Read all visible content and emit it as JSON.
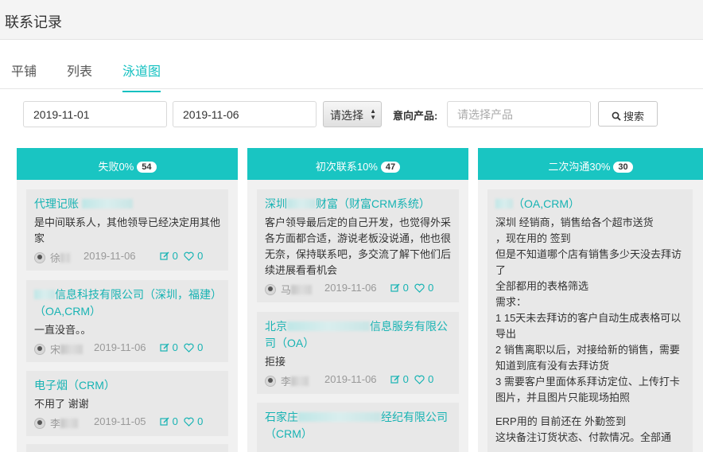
{
  "page": {
    "title": "联系记录"
  },
  "tabs": [
    {
      "label": "平铺",
      "active": false
    },
    {
      "label": "列表",
      "active": false
    },
    {
      "label": "泳道图",
      "active": true
    }
  ],
  "filters": {
    "start_date": "2019-11-01",
    "end_date": "2019-11-06",
    "select_value": "请选择",
    "product_label": "意向产品:",
    "product_placeholder": "请选择产品",
    "search_label": "搜索"
  },
  "colors": {
    "accent": "#19c5c2",
    "link": "#17b3b3"
  },
  "lanes": [
    {
      "title": "失败0%",
      "count": "54",
      "cards": [
        {
          "title": "代理记账",
          "desc": "是中间联系人，其他领导已经决定用其他家",
          "person": "徐",
          "date": "2019-11-06",
          "edits": "0",
          "likes": "0"
        },
        {
          "title": "信息科技有限公司（深圳，福建）（OA,CRM）",
          "desc": "一直没音。。",
          "person": "宋",
          "date": "2019-11-06",
          "edits": "0",
          "likes": "0"
        },
        {
          "title": "电子烟（CRM）",
          "desc": "不用了 谢谢",
          "person": "李",
          "date": "2019-11-05",
          "edits": "0",
          "likes": "0"
        }
      ]
    },
    {
      "title": "初次联系10%",
      "count": "47",
      "cards": [
        {
          "title_a": "深圳",
          "title_b": "财富（财富CRM系统）",
          "desc": "客户领导最后定的自己开发，也觉得外采各方面都合适，游说老板没说通，他也很无奈，保持联系吧，多交流了解下他们后续进展看看机会",
          "person": "马",
          "date": "2019-11-06",
          "edits": "0",
          "likes": "0"
        },
        {
          "title_a": "北京",
          "title_b": "信息服务有限公司（OA）",
          "desc": "拒接",
          "person": "李",
          "date": "2019-11-06",
          "edits": "0",
          "likes": "0"
        },
        {
          "title_a": "石家庄",
          "title_b": "经纪有限公司（CRM）",
          "desc": ""
        }
      ]
    },
    {
      "title": "二次沟通30%",
      "count": "30",
      "cards": [
        {
          "title": "（OA,CRM）",
          "lines": [
            "深圳 经销商，销售给各个超市送货",
            "，现在用的 签到",
            "但是不知道哪个店有销售多少天没去拜访了",
            "全部都用的表格筛选",
            "需求：",
            "1 15天未去拜访的客户自动生成表格可以导出",
            "2 销售离职以后，对接给新的销售，需要知道到底有没有去拜访货",
            "3 需要客户里面体系拜访定位、上传打卡图片，并且图片只能现场拍照",
            "ERP用的 目前还在 外勤签到",
            "这块备注订货状态、付款情况。全部通"
          ]
        }
      ]
    }
  ]
}
